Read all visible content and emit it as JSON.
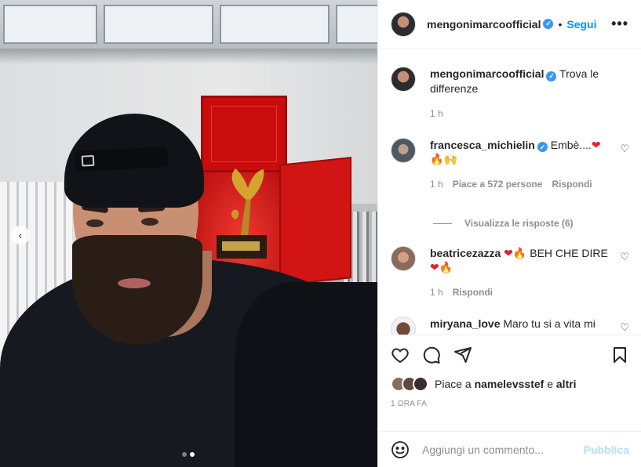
{
  "post": {
    "carousel": {
      "dot_count": 2,
      "active_index": 1,
      "prev_icon": "chevron-left"
    }
  },
  "header": {
    "username": "mengonimarcoofficial",
    "verified_icon": "verified-badge",
    "separator": "•",
    "follow_label": "Segui",
    "more_icon": "more-horizontal"
  },
  "comments": [
    {
      "username": "mengonimarcoofficial",
      "verified": true,
      "text": "Trova le differenze",
      "time": "1 h"
    },
    {
      "username": "francesca_michielin",
      "verified": true,
      "text": "Embè....",
      "time": "1 h",
      "likes": "Piace a 572 persone",
      "reply_label": "Rispondi",
      "view_replies": "Visualizza le risposte (6)"
    },
    {
      "username": "beatricezazza",
      "text": "BEH CHE DIRE",
      "time": "1 h",
      "reply_label": "Rispondi"
    },
    {
      "username": "miryana_love",
      "text": "Maro tu si a vita mi"
    }
  ],
  "actions": {
    "like_icon": "heart",
    "comment_icon": "comment",
    "share_icon": "paper-plane",
    "save_icon": "bookmark"
  },
  "likes": {
    "prefix": "Piace a",
    "user": "namelevsstef",
    "joiner": "e",
    "others": "altri"
  },
  "timestamp": "1 ORA FA",
  "add_comment": {
    "placeholder": "Aggiungi un commento...",
    "publish_label": "Pubblica",
    "emoji_icon": "smiley"
  },
  "colors": {
    "accent": "#0095f6",
    "muted": "#8e8e8e",
    "publish_disabled": "#b2dffc",
    "verified": "#3897f0"
  }
}
